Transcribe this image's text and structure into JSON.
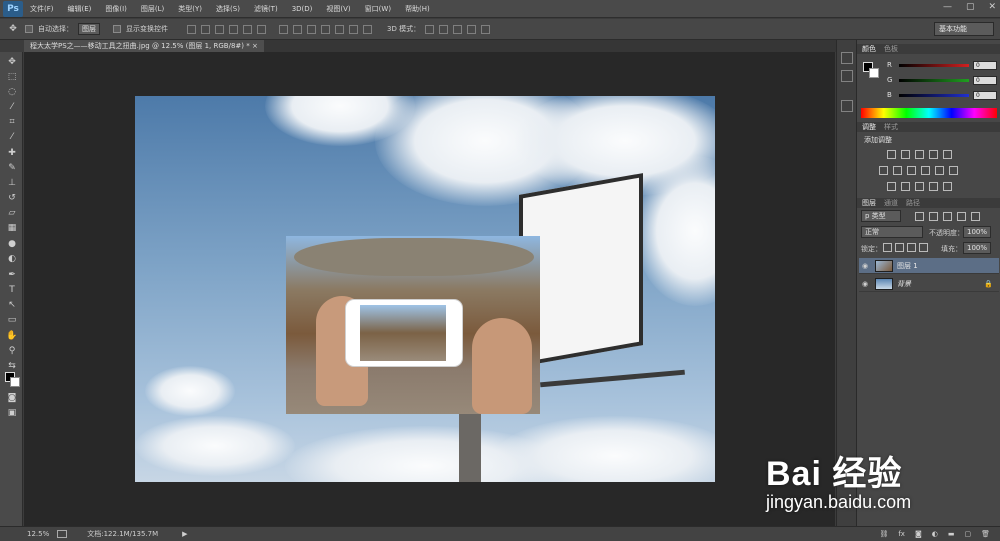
{
  "app": {
    "logo": "Ps"
  },
  "menu": [
    "文件(F)",
    "编辑(E)",
    "图像(I)",
    "图层(L)",
    "类型(Y)",
    "选择(S)",
    "滤镜(T)",
    "3D(D)",
    "视图(V)",
    "窗口(W)",
    "帮助(H)"
  ],
  "window_controls": {
    "minimize": "—",
    "restore": "▢",
    "close": "✕"
  },
  "options": {
    "auto_select_label": "自动选择：",
    "auto_select_value": "图层",
    "show_transform_label": "显示变换控件",
    "mode_3d_label": "3D 模式：",
    "workspace": "基本功能"
  },
  "document": {
    "tab_title": "程大太学PS之——移动工具之扭曲.jpg @ 12.5% (图层 1, RGB/8#) * ×"
  },
  "panels": {
    "color": {
      "tab_active": "颜色",
      "tab_inactive": "色板",
      "r_label": "R",
      "g_label": "G",
      "b_label": "B",
      "r_value": "0",
      "g_value": "0",
      "b_value": "0",
      "accent_r": "#d22020",
      "accent_g": "#20a020",
      "accent_b": "#2030d0"
    },
    "adjustments": {
      "tab_active": "调整",
      "tab_inactive": "样式",
      "add_label": "添加调整"
    },
    "layers": {
      "tab_active": "图层",
      "tab_2": "通道",
      "tab_3": "路径",
      "kind": "p 类型",
      "blend": "正常",
      "opacity_label": "不透明度：",
      "opacity_value": "100%",
      "lock_label": "锁定：",
      "fill_label": "填充：",
      "fill_value": "100%",
      "items": [
        {
          "name": "图层 1"
        },
        {
          "name": "背景"
        }
      ]
    }
  },
  "status": {
    "zoom": "12.5%",
    "doc_info": "文档:122.1M/135.7M"
  },
  "watermark": {
    "brand": "Bai 经验",
    "url": "jingyan.baidu.com"
  }
}
